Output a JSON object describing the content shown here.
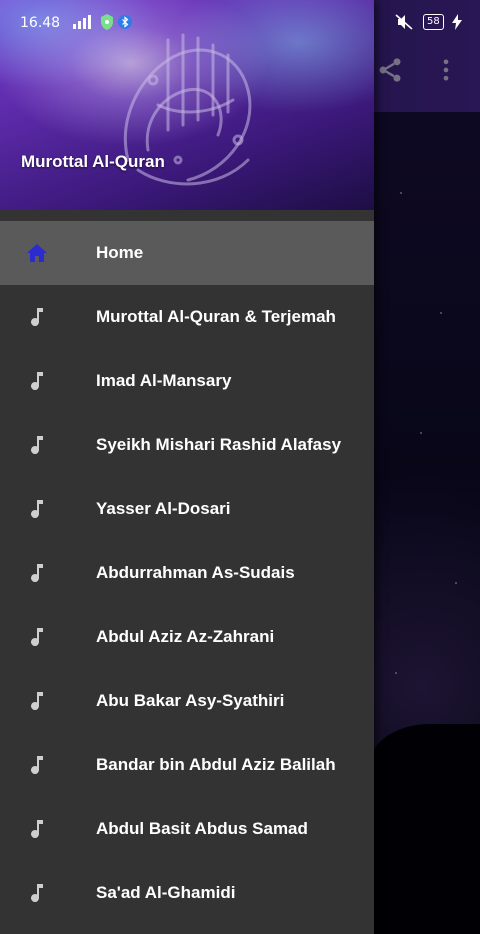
{
  "status_bar": {
    "time": "16.48",
    "battery": "58",
    "icons": [
      "signal-icon",
      "shield-icon",
      "bluetooth-icon",
      "mute-icon",
      "charge-icon"
    ]
  },
  "app_toolbar": {
    "icons": [
      "share-icon",
      "more-vert-icon"
    ]
  },
  "drawer": {
    "header_title": "Murottal Al-Quran",
    "items": [
      {
        "label": "Home",
        "icon": "home-icon",
        "active": true
      },
      {
        "label": "Murottal Al-Quran & Terjemah",
        "icon": "music-note-icon"
      },
      {
        "label": "Imad Al-Mansary",
        "icon": "music-note-icon"
      },
      {
        "label": "Syeikh Mishari Rashid Alafasy",
        "icon": "music-note-icon"
      },
      {
        "label": "Yasser Al-Dosari",
        "icon": "music-note-icon"
      },
      {
        "label": "Abdurrahman As-Sudais",
        "icon": "music-note-icon"
      },
      {
        "label": "Abdul Aziz Az-Zahrani",
        "icon": "music-note-icon"
      },
      {
        "label": "Abu Bakar Asy-Syathiri",
        "icon": "music-note-icon"
      },
      {
        "label": "Bandar bin Abdul Aziz Balilah",
        "icon": "music-note-icon"
      },
      {
        "label": "Abdul Basit Abdus Samad",
        "icon": "music-note-icon"
      },
      {
        "label": "Sa'ad Al-Ghamidi",
        "icon": "music-note-icon"
      }
    ]
  },
  "colors": {
    "drawer_bg": "#333333",
    "active_item_bg": "#5a5a5a",
    "home_icon": "#2b2bd0",
    "note_icon": "#cfcfcf"
  }
}
